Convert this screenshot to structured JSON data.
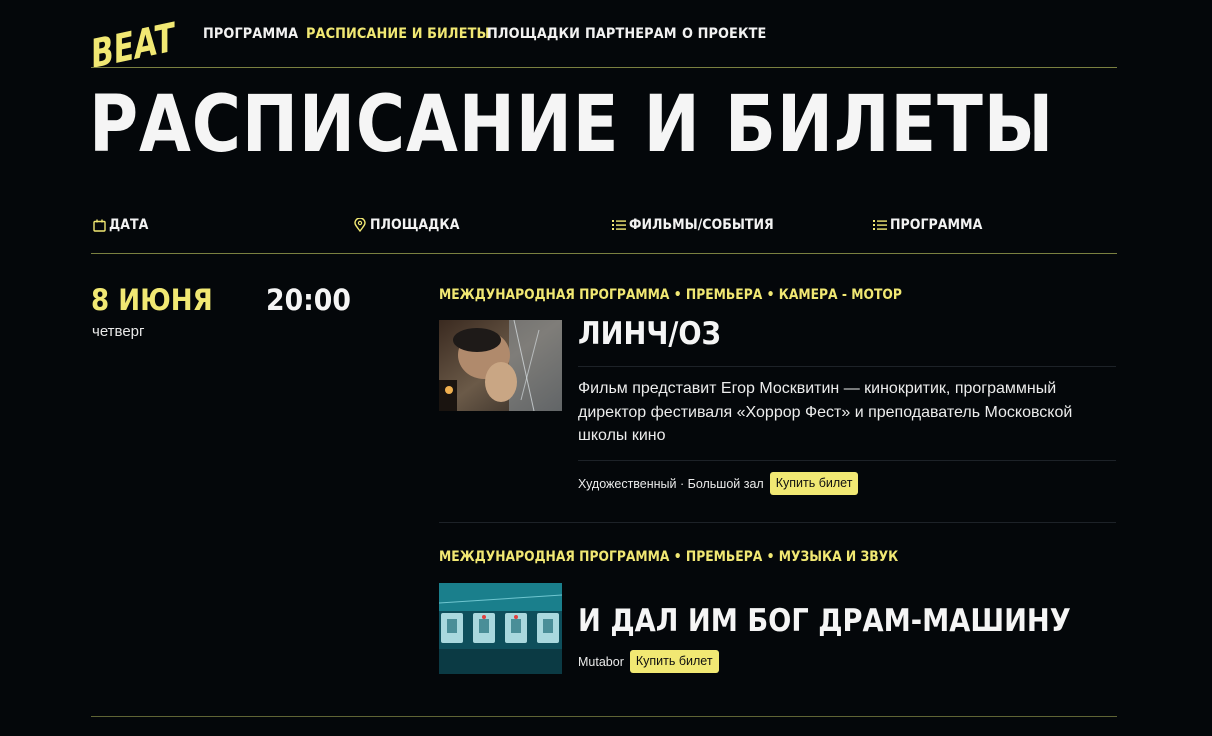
{
  "header": {
    "logo_text": "BEAT",
    "nav": [
      {
        "label": "ПРОГРАММА",
        "active": false
      },
      {
        "label": "РАСПИСАНИЕ И БИЛЕТЫ",
        "active": true
      },
      {
        "label": "ПЛОЩАДКИ",
        "active": false
      },
      {
        "label": "ПАРТНЕРАМ",
        "active": false
      },
      {
        "label": "О ПРОЕКТЕ",
        "active": false
      }
    ]
  },
  "page": {
    "title": "РАСПИСАНИЕ И БИЛЕТЫ"
  },
  "filters": [
    {
      "label": "ДАТА",
      "icon": "calendar-icon"
    },
    {
      "label": "ПЛОЩАДКА",
      "icon": "map-pin-icon"
    },
    {
      "label": "ФИЛЬМЫ/СОБЫТИЯ",
      "icon": "list-icon"
    },
    {
      "label": "ПРОГРАММА",
      "icon": "list-icon"
    }
  ],
  "schedule": {
    "date": "8 ИЮНЯ",
    "weekday": "четверг",
    "time": "20:00",
    "events": [
      {
        "tags": "МЕЖДУНАРОДНАЯ ПРОГРАММА • ПРЕМЬЕРА • КАМЕРА - МОТОР",
        "title": "ЛИНЧ/ОЗ",
        "description": "Фильм представит Егор Москвитин — кинокритик, программный директор фестиваля «Хоррор Фест» и преподаватель Московской школы кино",
        "meta": "Художественный · Большой зал",
        "buy_label": "Купить билет"
      },
      {
        "tags": "МЕЖДУНАРОДНАЯ ПРОГРАММА • ПРЕМЬЕРА • МУЗЫКА И ЗВУК",
        "title": "И ДАЛ ИМ БОГ ДРАМ-МАШИНУ",
        "meta": "Mutabor",
        "buy_label": "Купить билет"
      }
    ]
  },
  "colors": {
    "background": "#04070a",
    "accent": "#f1e873",
    "text": "#f5f5f5"
  }
}
